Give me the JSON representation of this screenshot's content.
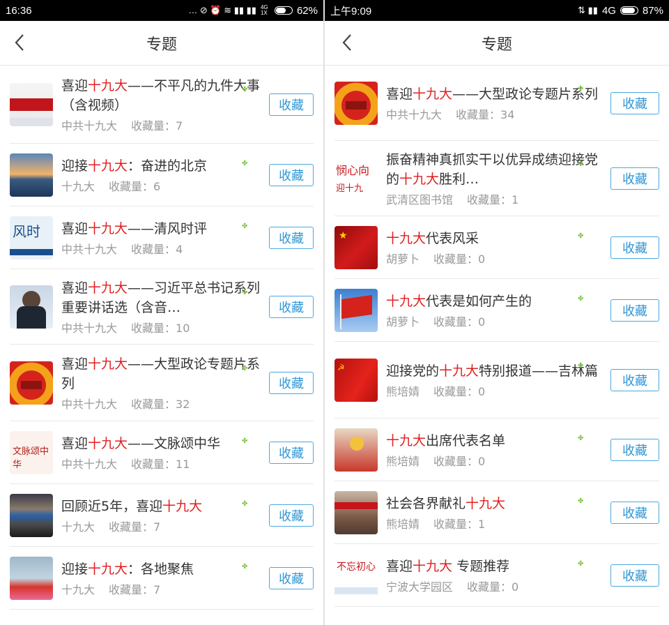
{
  "left": {
    "status": {
      "time": "16:36",
      "icons": "… ⊘ ⏰ ≋ ▮▮ ▮▮",
      "network_sub": "4G 1X",
      "battery": "62%",
      "battery_level": 0.62
    },
    "nav": {
      "title": "专题"
    },
    "items": [
      {
        "pre": "喜迎",
        "hl": "十九大",
        "post": "——不平凡的九件大事（含视频）",
        "author": "中共十九大",
        "count_label": "收藏量：",
        "count": "7",
        "button": "收藏",
        "thumb": "thumb-red-banner"
      },
      {
        "pre": "迎接",
        "hl": "十九大",
        "post": "：奋进的北京",
        "author": "十九大",
        "count_label": "收藏量：",
        "count": "6",
        "button": "收藏",
        "thumb": "thumb-sunset-city"
      },
      {
        "pre": "喜迎",
        "hl": "十九大",
        "post": "——清风时评",
        "author": "中共十九大",
        "count_label": "收藏量：",
        "count": "4",
        "button": "收藏",
        "thumb": "thumb-fengshi-text"
      },
      {
        "pre": "喜迎",
        "hl": "十九大",
        "post": "——习近平总书记系列重要讲话选（含音…",
        "author": "中共十九大",
        "count_label": "收藏量：",
        "count": "10",
        "button": "收藏",
        "thumb": "thumb-portrait"
      },
      {
        "pre": "喜迎",
        "hl": "十九大",
        "post": "——大型政论专题片系列",
        "author": "中共十九大",
        "count_label": "收藏量：",
        "count": "32",
        "button": "收藏",
        "thumb": "thumb-tiananmen-circle"
      },
      {
        "pre": "喜迎",
        "hl": "十九大",
        "post": "——文脉颂中华",
        "author": "中共十九大",
        "count_label": "收藏量：",
        "count": "11",
        "button": "收藏",
        "thumb": "thumb-wenmai-text"
      },
      {
        "pre": "回顾近5年，喜迎",
        "hl": "十九大",
        "post": "",
        "author": "十九大",
        "count_label": "收藏量：",
        "count": "7",
        "button": "收藏",
        "thumb": "thumb-hall"
      },
      {
        "pre": "迎接",
        "hl": "十九大",
        "post": "：各地聚焦",
        "author": "十九大",
        "count_label": "收藏量：",
        "count": "7",
        "button": "收藏",
        "thumb": "thumb-flowers"
      }
    ]
  },
  "right": {
    "status": {
      "time": "上午9:09",
      "icons": "⇅ ▮▮",
      "network": "4G",
      "battery": "87%",
      "battery_level": 0.87
    },
    "nav": {
      "title": "专题"
    },
    "items": [
      {
        "pre": "喜迎",
        "hl": "十九大",
        "post": "——大型政论专题片系列",
        "author": "中共十九大",
        "count_label": "收藏量：",
        "count": "34",
        "button": "收藏",
        "thumb": "thumb-tiananmen-circle"
      },
      {
        "pre": "振奋精神真抓实干以优异成绩迎接党的",
        "hl": "十九大",
        "post": "胜利…",
        "author": "武清区图书馆",
        "count_label": "收藏量：",
        "count": "1",
        "button": "收藏",
        "thumb": "thumb-heart-text"
      },
      {
        "pre": "",
        "hl": "十九大",
        "post": "代表风采",
        "author": "胡萝卜",
        "count_label": "收藏量：",
        "count": "0",
        "button": "收藏",
        "thumb": "thumb-red-flag"
      },
      {
        "pre": "",
        "hl": "十九大",
        "post": "代表是如何产生的",
        "author": "胡萝卜",
        "count_label": "收藏量：",
        "count": "0",
        "button": "收藏",
        "thumb": "thumb-flag-sky"
      },
      {
        "pre": "迎接党的",
        "hl": "十九大",
        "post": "特别报道——吉林篇",
        "author": "熊培婧",
        "count_label": "收藏量：",
        "count": "0",
        "button": "收藏",
        "thumb": "thumb-party-flag"
      },
      {
        "pre": "",
        "hl": "十九大",
        "post": "出席代表名单",
        "author": "熊培婧",
        "count_label": "收藏量：",
        "count": "0",
        "button": "收藏",
        "thumb": "thumb-emblem"
      },
      {
        "pre": "社会各界献礼",
        "hl": "十九大",
        "post": "",
        "author": "熊培婧",
        "count_label": "收藏量：",
        "count": "1",
        "button": "收藏",
        "thumb": "thumb-building"
      },
      {
        "pre": "喜迎",
        "hl": "十九大",
        "post": " 专题推荐",
        "author": "宁波大学园区",
        "count_label": "收藏量：",
        "count": "0",
        "button": "收藏",
        "thumb": "thumb-calligraphy"
      }
    ]
  }
}
